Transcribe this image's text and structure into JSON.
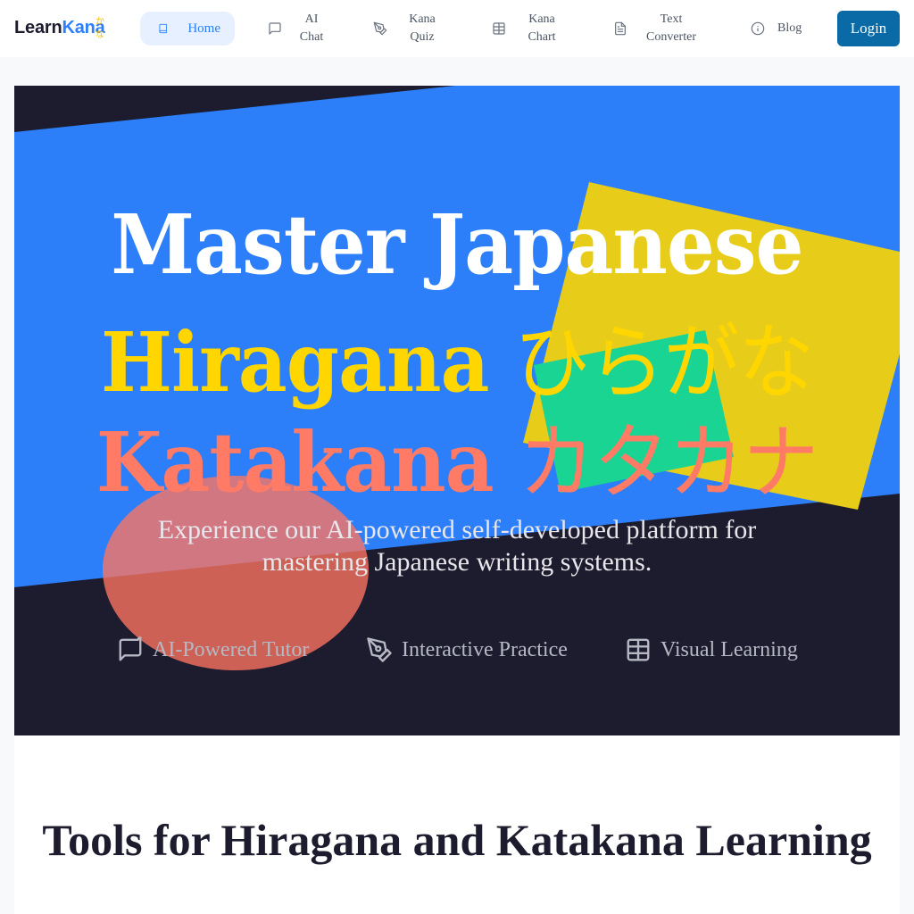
{
  "brand": {
    "name_part1": "Learn",
    "name_part2": "Kana",
    "superscript": "かな"
  },
  "nav": {
    "items": [
      {
        "label": "Home",
        "icon": "book-icon",
        "active": true
      },
      {
        "label_line1": "AI",
        "label_line2": "Chat",
        "icon": "message-square-icon"
      },
      {
        "label_line1": "Kana",
        "label_line2": "Quiz",
        "icon": "pen-tool-icon"
      },
      {
        "label_line1": "Kana",
        "label_line2": "Chart",
        "icon": "table-icon"
      },
      {
        "label_line1": "Text",
        "label_line2": "Converter",
        "icon": "file-text-icon"
      },
      {
        "label": "Blog",
        "icon": "info-icon"
      }
    ],
    "login_label": "Login"
  },
  "hero": {
    "title_line1": "Master Japanese",
    "title_line2_en": "Hiragana",
    "title_line2_jp": "ひらがな",
    "title_line3_en": "Katakana",
    "title_line3_jp": "カタカナ",
    "subtitle": "Experience our AI-powered self-developed platform for mastering Japanese writing systems.",
    "features": [
      {
        "label": "AI-Powered Tutor",
        "icon": "message-square-icon"
      },
      {
        "label": "Interactive Practice",
        "icon": "pen-tool-icon"
      },
      {
        "label": "Visual Learning",
        "icon": "table-icon"
      }
    ]
  },
  "tools": {
    "heading": "Tools for Hiragana and Katakana Learning"
  },
  "colors": {
    "accent_blue": "#2d7ff9",
    "dark_navy": "#1c1c2e",
    "yellow": "#ffd600",
    "coral": "#ff7b66",
    "teal": "#19d492",
    "login_bg": "#0a6aa6"
  }
}
